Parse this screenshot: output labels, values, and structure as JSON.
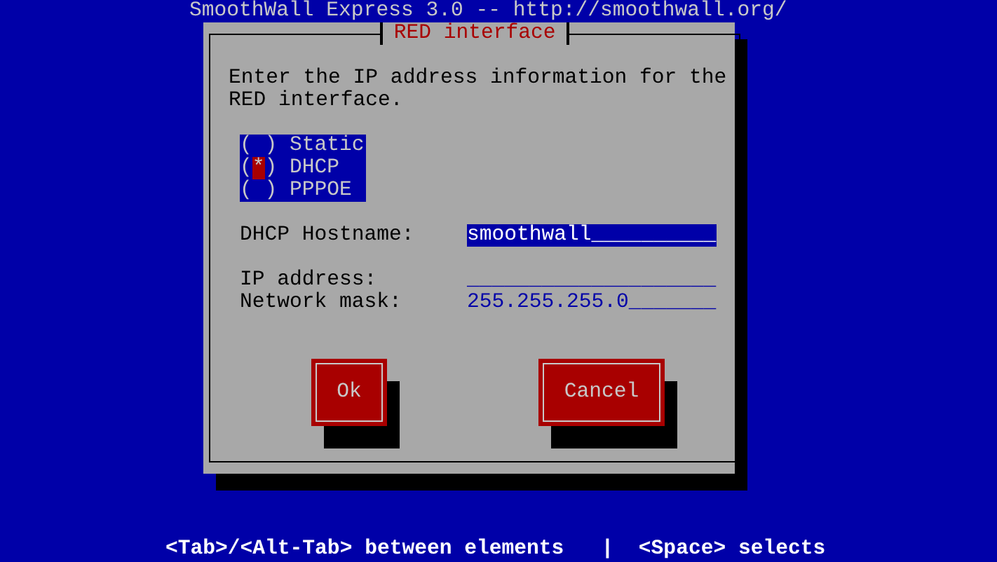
{
  "header": "SmoothWall Express 3.0 -- http://smoothwall.org/",
  "dialog": {
    "title": "RED interface",
    "message": "Enter the IP address information for the RED interface.",
    "radio_marks": {
      "open": "(",
      "close": ")",
      "on": "*"
    },
    "radios": [
      {
        "label": "Static",
        "selected": false
      },
      {
        "label": "DHCP",
        "selected": true
      },
      {
        "label": "PPPOE",
        "selected": false
      }
    ],
    "fields": [
      {
        "label": "DHCP Hostname:",
        "value": "smoothwall__________",
        "focused": true
      },
      {
        "label": "IP address:",
        "value": "____________________",
        "focused": false
      },
      {
        "label": "Network mask:",
        "value": "255.255.255.0_______",
        "focused": false
      }
    ],
    "buttons": [
      "Ok",
      "Cancel"
    ]
  },
  "status_bar": "<Tab>/<Alt-Tab> between elements   |  <Space> selects"
}
